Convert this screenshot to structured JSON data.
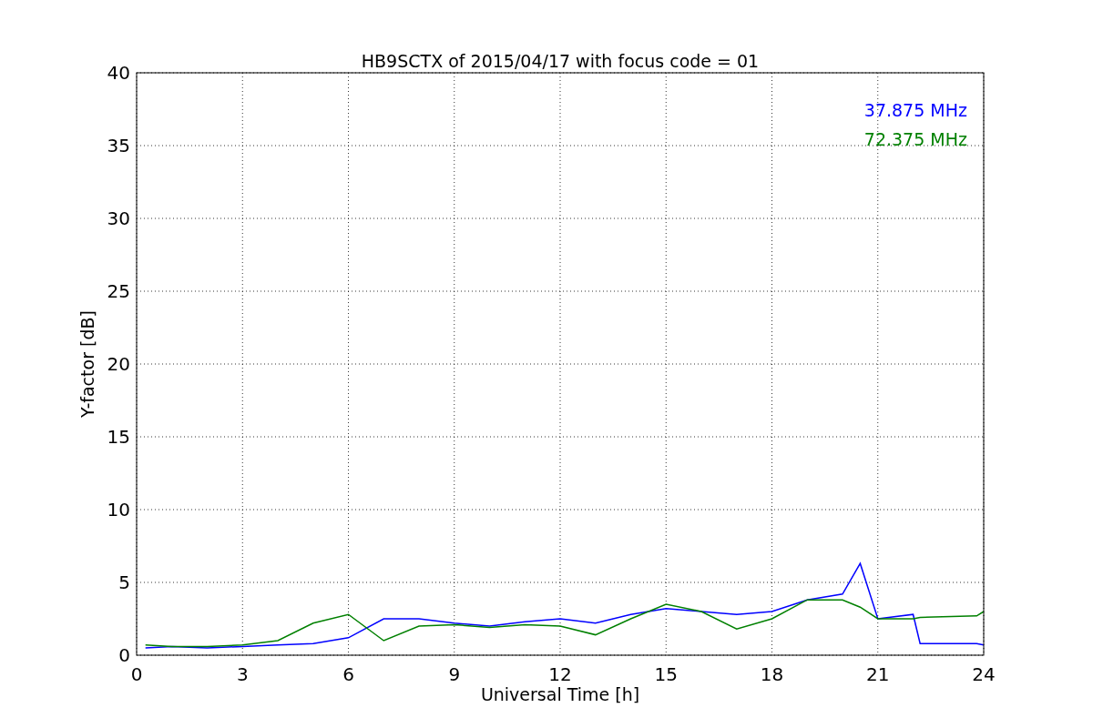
{
  "figure": {
    "chart_data": {
      "type": "line",
      "title": "HB9SCTX of 2015/04/17 with focus code = 01",
      "xlabel": "Universal Time [h]",
      "ylabel": "Y-factor [dB]",
      "grid": true,
      "xlim": [
        0,
        24
      ],
      "ylim": [
        0,
        40
      ],
      "xticks": [
        0,
        3,
        6,
        9,
        12,
        15,
        18,
        21,
        24
      ],
      "yticks": [
        0,
        5,
        10,
        15,
        20,
        25,
        30,
        35,
        40
      ],
      "x": [
        0.25,
        1,
        2,
        3,
        4,
        5,
        6,
        7,
        8,
        9,
        10,
        11,
        12,
        13,
        14,
        15,
        16,
        17,
        18,
        19,
        20,
        20.5,
        21,
        22,
        22.2,
        23.8,
        24
      ],
      "series": [
        {
          "name": "37.875 MHz",
          "color": "#0000ff",
          "values": [
            0.5,
            0.6,
            0.5,
            0.6,
            0.7,
            0.8,
            1.2,
            2.5,
            2.5,
            2.2,
            2.0,
            2.3,
            2.5,
            2.2,
            2.8,
            3.2,
            3.0,
            2.8,
            3.0,
            3.8,
            4.2,
            6.3,
            2.5,
            2.8,
            0.8,
            0.8,
            0.7
          ]
        },
        {
          "name": "72.375 MHz",
          "color": "#008000",
          "values": [
            0.7,
            0.6,
            0.6,
            0.7,
            1.0,
            2.2,
            2.8,
            1.0,
            2.0,
            2.1,
            1.9,
            2.1,
            2.0,
            1.4,
            2.5,
            3.5,
            3.0,
            1.8,
            2.5,
            3.8,
            3.8,
            3.3,
            2.5,
            2.5,
            2.6,
            2.7,
            3.0
          ]
        }
      ]
    }
  }
}
